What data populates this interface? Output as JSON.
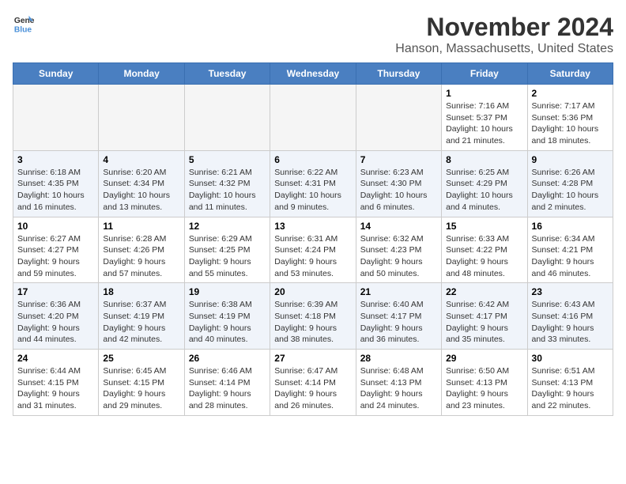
{
  "logo": {
    "line1": "General",
    "line2": "Blue"
  },
  "title": "November 2024",
  "subtitle": "Hanson, Massachusetts, United States",
  "days_of_week": [
    "Sunday",
    "Monday",
    "Tuesday",
    "Wednesday",
    "Thursday",
    "Friday",
    "Saturday"
  ],
  "weeks": [
    [
      {
        "day": "",
        "info": "",
        "empty": true
      },
      {
        "day": "",
        "info": "",
        "empty": true
      },
      {
        "day": "",
        "info": "",
        "empty": true
      },
      {
        "day": "",
        "info": "",
        "empty": true
      },
      {
        "day": "",
        "info": "",
        "empty": true
      },
      {
        "day": "1",
        "info": "Sunrise: 7:16 AM\nSunset: 5:37 PM\nDaylight: 10 hours and 21 minutes.",
        "empty": false
      },
      {
        "day": "2",
        "info": "Sunrise: 7:17 AM\nSunset: 5:36 PM\nDaylight: 10 hours and 18 minutes.",
        "empty": false
      }
    ],
    [
      {
        "day": "3",
        "info": "Sunrise: 6:18 AM\nSunset: 4:35 PM\nDaylight: 10 hours and 16 minutes.",
        "empty": false
      },
      {
        "day": "4",
        "info": "Sunrise: 6:20 AM\nSunset: 4:34 PM\nDaylight: 10 hours and 13 minutes.",
        "empty": false
      },
      {
        "day": "5",
        "info": "Sunrise: 6:21 AM\nSunset: 4:32 PM\nDaylight: 10 hours and 11 minutes.",
        "empty": false
      },
      {
        "day": "6",
        "info": "Sunrise: 6:22 AM\nSunset: 4:31 PM\nDaylight: 10 hours and 9 minutes.",
        "empty": false
      },
      {
        "day": "7",
        "info": "Sunrise: 6:23 AM\nSunset: 4:30 PM\nDaylight: 10 hours and 6 minutes.",
        "empty": false
      },
      {
        "day": "8",
        "info": "Sunrise: 6:25 AM\nSunset: 4:29 PM\nDaylight: 10 hours and 4 minutes.",
        "empty": false
      },
      {
        "day": "9",
        "info": "Sunrise: 6:26 AM\nSunset: 4:28 PM\nDaylight: 10 hours and 2 minutes.",
        "empty": false
      }
    ],
    [
      {
        "day": "10",
        "info": "Sunrise: 6:27 AM\nSunset: 4:27 PM\nDaylight: 9 hours and 59 minutes.",
        "empty": false
      },
      {
        "day": "11",
        "info": "Sunrise: 6:28 AM\nSunset: 4:26 PM\nDaylight: 9 hours and 57 minutes.",
        "empty": false
      },
      {
        "day": "12",
        "info": "Sunrise: 6:29 AM\nSunset: 4:25 PM\nDaylight: 9 hours and 55 minutes.",
        "empty": false
      },
      {
        "day": "13",
        "info": "Sunrise: 6:31 AM\nSunset: 4:24 PM\nDaylight: 9 hours and 53 minutes.",
        "empty": false
      },
      {
        "day": "14",
        "info": "Sunrise: 6:32 AM\nSunset: 4:23 PM\nDaylight: 9 hours and 50 minutes.",
        "empty": false
      },
      {
        "day": "15",
        "info": "Sunrise: 6:33 AM\nSunset: 4:22 PM\nDaylight: 9 hours and 48 minutes.",
        "empty": false
      },
      {
        "day": "16",
        "info": "Sunrise: 6:34 AM\nSunset: 4:21 PM\nDaylight: 9 hours and 46 minutes.",
        "empty": false
      }
    ],
    [
      {
        "day": "17",
        "info": "Sunrise: 6:36 AM\nSunset: 4:20 PM\nDaylight: 9 hours and 44 minutes.",
        "empty": false
      },
      {
        "day": "18",
        "info": "Sunrise: 6:37 AM\nSunset: 4:19 PM\nDaylight: 9 hours and 42 minutes.",
        "empty": false
      },
      {
        "day": "19",
        "info": "Sunrise: 6:38 AM\nSunset: 4:19 PM\nDaylight: 9 hours and 40 minutes.",
        "empty": false
      },
      {
        "day": "20",
        "info": "Sunrise: 6:39 AM\nSunset: 4:18 PM\nDaylight: 9 hours and 38 minutes.",
        "empty": false
      },
      {
        "day": "21",
        "info": "Sunrise: 6:40 AM\nSunset: 4:17 PM\nDaylight: 9 hours and 36 minutes.",
        "empty": false
      },
      {
        "day": "22",
        "info": "Sunrise: 6:42 AM\nSunset: 4:17 PM\nDaylight: 9 hours and 35 minutes.",
        "empty": false
      },
      {
        "day": "23",
        "info": "Sunrise: 6:43 AM\nSunset: 4:16 PM\nDaylight: 9 hours and 33 minutes.",
        "empty": false
      }
    ],
    [
      {
        "day": "24",
        "info": "Sunrise: 6:44 AM\nSunset: 4:15 PM\nDaylight: 9 hours and 31 minutes.",
        "empty": false
      },
      {
        "day": "25",
        "info": "Sunrise: 6:45 AM\nSunset: 4:15 PM\nDaylight: 9 hours and 29 minutes.",
        "empty": false
      },
      {
        "day": "26",
        "info": "Sunrise: 6:46 AM\nSunset: 4:14 PM\nDaylight: 9 hours and 28 minutes.",
        "empty": false
      },
      {
        "day": "27",
        "info": "Sunrise: 6:47 AM\nSunset: 4:14 PM\nDaylight: 9 hours and 26 minutes.",
        "empty": false
      },
      {
        "day": "28",
        "info": "Sunrise: 6:48 AM\nSunset: 4:13 PM\nDaylight: 9 hours and 24 minutes.",
        "empty": false
      },
      {
        "day": "29",
        "info": "Sunrise: 6:50 AM\nSunset: 4:13 PM\nDaylight: 9 hours and 23 minutes.",
        "empty": false
      },
      {
        "day": "30",
        "info": "Sunrise: 6:51 AM\nSunset: 4:13 PM\nDaylight: 9 hours and 22 minutes.",
        "empty": false
      }
    ]
  ]
}
